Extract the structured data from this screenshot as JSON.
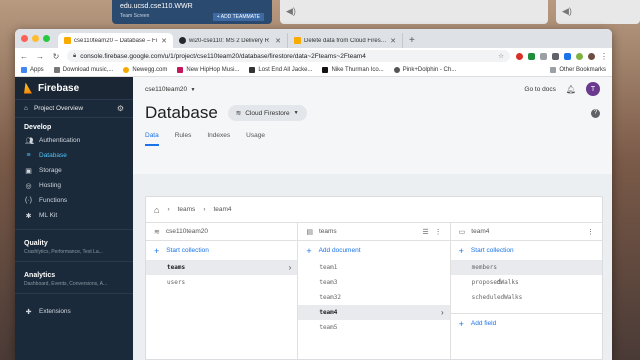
{
  "background_windows": {
    "win1_title": "edu.ucsd.cse110.WWR",
    "win1_sub": "Team Screen",
    "win1_button": "+ ADD TEAMMATE"
  },
  "browser": {
    "tabs": [
      {
        "title": "cse110team20 – Database – Fi",
        "active": true,
        "color": "#f9ab00"
      },
      {
        "title": "wi20-cse110: MS 2 Delivery R",
        "active": false,
        "color": "#24292e"
      },
      {
        "title": "Delete data from Cloud Firestore",
        "active": false,
        "color": "#f9ab00"
      }
    ],
    "new_tab": "+",
    "url": "console.firebase.google.com/u/1/project/cse110team20/database/firestore/data~2Fteams~2Fteam4",
    "bookmarks": [
      {
        "label": "Apps",
        "color": "#4285f4"
      },
      {
        "label": "Download music,...",
        "color": "#777777"
      },
      {
        "label": "Newegg.com",
        "color": "#f7a900"
      },
      {
        "label": "New HipHop Musi...",
        "color": "#c2185b"
      },
      {
        "label": "Lost End All Jacke...",
        "color": "#333333"
      },
      {
        "label": "Nike Thurman Ico...",
        "color": "#111111"
      },
      {
        "label": "Pink+Dolphin - Ch...",
        "color": "#555555"
      }
    ],
    "other_bookmarks": "Other Bookmarks"
  },
  "sidebar": {
    "brand": "Firebase",
    "project_overview": "Project Overview",
    "develop": "Develop",
    "items": [
      {
        "label": "Authentication",
        "icon": "people-icon"
      },
      {
        "label": "Database",
        "icon": "database-icon",
        "active": true
      },
      {
        "label": "Storage",
        "icon": "storage-icon"
      },
      {
        "label": "Hosting",
        "icon": "hosting-icon"
      },
      {
        "label": "Functions",
        "icon": "functions-icon"
      },
      {
        "label": "ML Kit",
        "icon": "ml-kit-icon"
      }
    ],
    "quality": "Quality",
    "quality_sub": "Crashlytics, Performance, Test La...",
    "analytics": "Analytics",
    "analytics_sub": "Dashboard, Events, Conversions, A...",
    "extensions": "Extensions"
  },
  "header": {
    "project": "cse110team20",
    "go_to_docs": "Go to docs",
    "avatar": "T",
    "title": "Database",
    "chip": "Cloud Firestore",
    "help": "?",
    "tabs": [
      "Data",
      "Rules",
      "Indexes",
      "Usage"
    ]
  },
  "breadcrumb": [
    "teams",
    "team4"
  ],
  "columns": {
    "root": {
      "title": "cse110team20",
      "add": "Start collection",
      "rows": [
        "teams",
        "users"
      ],
      "selected": "teams"
    },
    "collection": {
      "title": "teams",
      "add": "Add document",
      "rows": [
        "team1",
        "team3",
        "team32",
        "team4",
        "team5"
      ],
      "selected": "team4"
    },
    "document": {
      "title": "team4",
      "add": "Start collection",
      "rows": [
        "members",
        "proposedWalks",
        "scheduledWalks"
      ],
      "add_field": "Add field"
    }
  }
}
